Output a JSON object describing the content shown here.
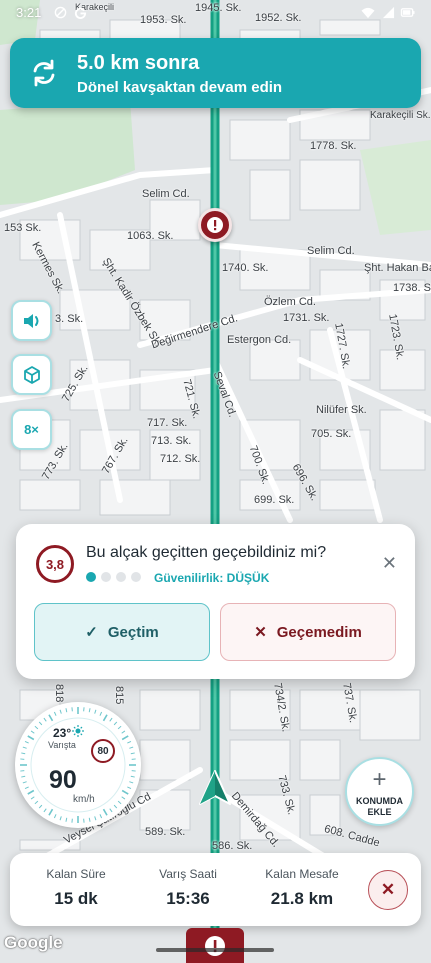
{
  "status_bar": {
    "time": "3:21"
  },
  "navigation": {
    "distance": "5.0 km sonra",
    "instruction": "Dönel kavşaktan devam edin",
    "icon": "roundabout-icon"
  },
  "side_buttons": [
    {
      "name": "sound-toggle-button",
      "icon": "volume-icon"
    },
    {
      "name": "3d-view-button",
      "icon": "cube-icon"
    },
    {
      "name": "speed-multiplier-button",
      "label": "8×"
    }
  ],
  "map": {
    "street_labels": [
      "Karakeçili",
      "1953. Sk.",
      "1945. Sk.",
      "1952. Sk.",
      "Karakeçili Sk.",
      "1778. Sk.",
      "Selim Cd.",
      "Selim Cd.",
      "153 Sk.",
      "1063. Sk.",
      "Kermes Sk.",
      "Şht. Kadir Özbek Sk.",
      "1740. Sk.",
      "Şht. Hakan Ba",
      "1738. Sk.",
      "Özlem Cd.",
      "1731. Sk.",
      "3. Sk.",
      "Değirmendere Cd.",
      "Estergon Cd.",
      "1727. Sk.",
      "1723. Sk.",
      "Seval Cd.",
      "721. Sk.",
      "725. Sk.",
      "717. Sk.",
      "713. Sk.",
      "712. Sk.",
      "Nilüfer Sk.",
      "705. Sk.",
      "700. Sk.",
      "696. Sk.",
      "699. Sk.",
      "767. Sk.",
      "773. Sk.",
      "734/2. Sk.",
      "737. Sk.",
      "815",
      "818",
      "733. Sk.",
      "Demirdağ Cd.",
      "608. Cadde",
      "Veysel Şatıroğlu Cd",
      "589. Sk.",
      "586. Sk."
    ]
  },
  "question": {
    "height_badge": "3,8",
    "text": "Bu alçak geçitten geçebildiniz mi?",
    "reliability": "Güvenilirlik: DÜŞÜK",
    "reliability_level": 1,
    "reliability_max": 4,
    "button_passed": "Geçtim",
    "button_failed": "Geçemedim"
  },
  "speedometer": {
    "temperature": "23°",
    "temperature_label": "Varışta",
    "speed_limit": "80",
    "speed": "90",
    "unit": "km/h"
  },
  "add_location": {
    "label": "KONUMDA EKLE"
  },
  "trip": {
    "remaining_time_label": "Kalan Süre",
    "remaining_time": "15 dk",
    "arrival_label": "Varış Saati",
    "arrival": "15:36",
    "remaining_distance_label": "Kalan Mesafe",
    "remaining_distance": "21.8 km"
  },
  "attribution": "Google",
  "colors": {
    "accent": "#1aa7b0",
    "route": "#14a083",
    "hazard": "#8e1a23",
    "warning_low": "#1aa7b0"
  }
}
